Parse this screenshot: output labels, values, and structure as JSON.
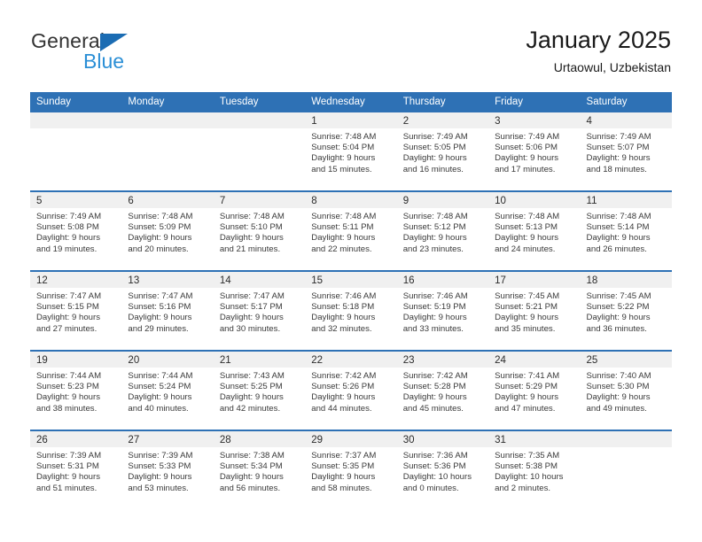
{
  "brand": {
    "word_one": "General",
    "word_two": "Blue",
    "triangle_icon": "blue-triangle-logo-mark",
    "color_dark": "#333333",
    "color_blue": "#2b8fd6",
    "color_triangle": "#1b6cb3"
  },
  "header": {
    "title": "January 2025",
    "subtitle": "Urtaowul, Uzbekistan"
  },
  "theme": {
    "header_bg": "#2e71b5",
    "header_text": "#ffffff",
    "daynum_band_bg": "#f0f0f0",
    "row_divider": "#2e71b5",
    "body_text": "#3a3a3a"
  },
  "calendar": {
    "day_headers": [
      "Sunday",
      "Monday",
      "Tuesday",
      "Wednesday",
      "Thursday",
      "Friday",
      "Saturday"
    ],
    "weeks": [
      [
        {
          "day": "",
          "lines": []
        },
        {
          "day": "",
          "lines": []
        },
        {
          "day": "",
          "lines": []
        },
        {
          "day": "1",
          "lines": [
            "Sunrise: 7:48 AM",
            "Sunset: 5:04 PM",
            "Daylight: 9 hours",
            "and 15 minutes."
          ]
        },
        {
          "day": "2",
          "lines": [
            "Sunrise: 7:49 AM",
            "Sunset: 5:05 PM",
            "Daylight: 9 hours",
            "and 16 minutes."
          ]
        },
        {
          "day": "3",
          "lines": [
            "Sunrise: 7:49 AM",
            "Sunset: 5:06 PM",
            "Daylight: 9 hours",
            "and 17 minutes."
          ]
        },
        {
          "day": "4",
          "lines": [
            "Sunrise: 7:49 AM",
            "Sunset: 5:07 PM",
            "Daylight: 9 hours",
            "and 18 minutes."
          ]
        }
      ],
      [
        {
          "day": "5",
          "lines": [
            "Sunrise: 7:49 AM",
            "Sunset: 5:08 PM",
            "Daylight: 9 hours",
            "and 19 minutes."
          ]
        },
        {
          "day": "6",
          "lines": [
            "Sunrise: 7:48 AM",
            "Sunset: 5:09 PM",
            "Daylight: 9 hours",
            "and 20 minutes."
          ]
        },
        {
          "day": "7",
          "lines": [
            "Sunrise: 7:48 AM",
            "Sunset: 5:10 PM",
            "Daylight: 9 hours",
            "and 21 minutes."
          ]
        },
        {
          "day": "8",
          "lines": [
            "Sunrise: 7:48 AM",
            "Sunset: 5:11 PM",
            "Daylight: 9 hours",
            "and 22 minutes."
          ]
        },
        {
          "day": "9",
          "lines": [
            "Sunrise: 7:48 AM",
            "Sunset: 5:12 PM",
            "Daylight: 9 hours",
            "and 23 minutes."
          ]
        },
        {
          "day": "10",
          "lines": [
            "Sunrise: 7:48 AM",
            "Sunset: 5:13 PM",
            "Daylight: 9 hours",
            "and 24 minutes."
          ]
        },
        {
          "day": "11",
          "lines": [
            "Sunrise: 7:48 AM",
            "Sunset: 5:14 PM",
            "Daylight: 9 hours",
            "and 26 minutes."
          ]
        }
      ],
      [
        {
          "day": "12",
          "lines": [
            "Sunrise: 7:47 AM",
            "Sunset: 5:15 PM",
            "Daylight: 9 hours",
            "and 27 minutes."
          ]
        },
        {
          "day": "13",
          "lines": [
            "Sunrise: 7:47 AM",
            "Sunset: 5:16 PM",
            "Daylight: 9 hours",
            "and 29 minutes."
          ]
        },
        {
          "day": "14",
          "lines": [
            "Sunrise: 7:47 AM",
            "Sunset: 5:17 PM",
            "Daylight: 9 hours",
            "and 30 minutes."
          ]
        },
        {
          "day": "15",
          "lines": [
            "Sunrise: 7:46 AM",
            "Sunset: 5:18 PM",
            "Daylight: 9 hours",
            "and 32 minutes."
          ]
        },
        {
          "day": "16",
          "lines": [
            "Sunrise: 7:46 AM",
            "Sunset: 5:19 PM",
            "Daylight: 9 hours",
            "and 33 minutes."
          ]
        },
        {
          "day": "17",
          "lines": [
            "Sunrise: 7:45 AM",
            "Sunset: 5:21 PM",
            "Daylight: 9 hours",
            "and 35 minutes."
          ]
        },
        {
          "day": "18",
          "lines": [
            "Sunrise: 7:45 AM",
            "Sunset: 5:22 PM",
            "Daylight: 9 hours",
            "and 36 minutes."
          ]
        }
      ],
      [
        {
          "day": "19",
          "lines": [
            "Sunrise: 7:44 AM",
            "Sunset: 5:23 PM",
            "Daylight: 9 hours",
            "and 38 minutes."
          ]
        },
        {
          "day": "20",
          "lines": [
            "Sunrise: 7:44 AM",
            "Sunset: 5:24 PM",
            "Daylight: 9 hours",
            "and 40 minutes."
          ]
        },
        {
          "day": "21",
          "lines": [
            "Sunrise: 7:43 AM",
            "Sunset: 5:25 PM",
            "Daylight: 9 hours",
            "and 42 minutes."
          ]
        },
        {
          "day": "22",
          "lines": [
            "Sunrise: 7:42 AM",
            "Sunset: 5:26 PM",
            "Daylight: 9 hours",
            "and 44 minutes."
          ]
        },
        {
          "day": "23",
          "lines": [
            "Sunrise: 7:42 AM",
            "Sunset: 5:28 PM",
            "Daylight: 9 hours",
            "and 45 minutes."
          ]
        },
        {
          "day": "24",
          "lines": [
            "Sunrise: 7:41 AM",
            "Sunset: 5:29 PM",
            "Daylight: 9 hours",
            "and 47 minutes."
          ]
        },
        {
          "day": "25",
          "lines": [
            "Sunrise: 7:40 AM",
            "Sunset: 5:30 PM",
            "Daylight: 9 hours",
            "and 49 minutes."
          ]
        }
      ],
      [
        {
          "day": "26",
          "lines": [
            "Sunrise: 7:39 AM",
            "Sunset: 5:31 PM",
            "Daylight: 9 hours",
            "and 51 minutes."
          ]
        },
        {
          "day": "27",
          "lines": [
            "Sunrise: 7:39 AM",
            "Sunset: 5:33 PM",
            "Daylight: 9 hours",
            "and 53 minutes."
          ]
        },
        {
          "day": "28",
          "lines": [
            "Sunrise: 7:38 AM",
            "Sunset: 5:34 PM",
            "Daylight: 9 hours",
            "and 56 minutes."
          ]
        },
        {
          "day": "29",
          "lines": [
            "Sunrise: 7:37 AM",
            "Sunset: 5:35 PM",
            "Daylight: 9 hours",
            "and 58 minutes."
          ]
        },
        {
          "day": "30",
          "lines": [
            "Sunrise: 7:36 AM",
            "Sunset: 5:36 PM",
            "Daylight: 10 hours",
            "and 0 minutes."
          ]
        },
        {
          "day": "31",
          "lines": [
            "Sunrise: 7:35 AM",
            "Sunset: 5:38 PM",
            "Daylight: 10 hours",
            "and 2 minutes."
          ]
        },
        {
          "day": "",
          "lines": []
        }
      ]
    ]
  }
}
